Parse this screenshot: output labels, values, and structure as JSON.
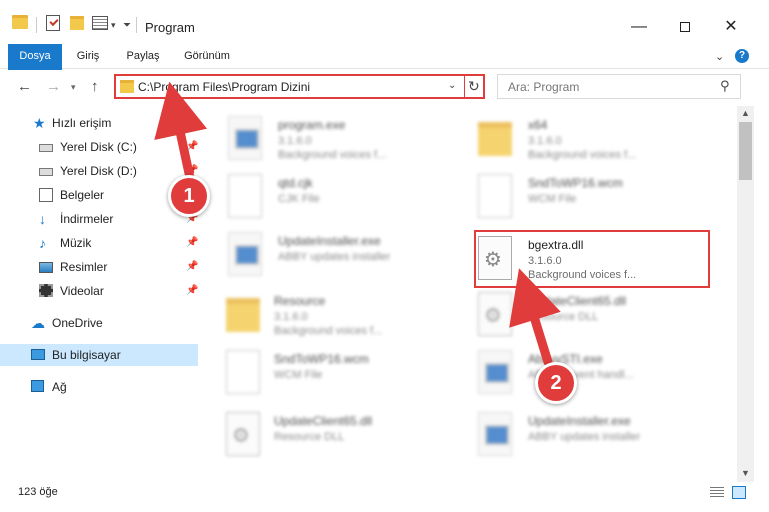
{
  "window": {
    "title": "Program",
    "minimize": "—",
    "close": "✕"
  },
  "ribbon": {
    "tabs": [
      "Dosya",
      "Giriş",
      "Paylaş",
      "Görünüm"
    ],
    "help": "?"
  },
  "address": {
    "path": "C:\\Program Files\\Program Dizini"
  },
  "search": {
    "placeholder": "Ara: Program"
  },
  "sidebar": {
    "items": [
      {
        "label": "Hızlı erişim",
        "icon": "star-icon"
      },
      {
        "label": "Yerel Disk (C:)",
        "icon": "drive-icon"
      },
      {
        "label": "Yerel Disk (D:)",
        "icon": "drive-icon"
      },
      {
        "label": "Belgeler",
        "icon": "documents-icon"
      },
      {
        "label": "İndirmeler",
        "icon": "download-icon"
      },
      {
        "label": "Müzik",
        "icon": "music-icon"
      },
      {
        "label": "Resimler",
        "icon": "pictures-icon"
      },
      {
        "label": "Videolar",
        "icon": "video-icon"
      },
      {
        "label": "OneDrive",
        "icon": "cloud-icon"
      },
      {
        "label": "Bu bilgisayar",
        "icon": "computer-icon"
      },
      {
        "label": "Ağ",
        "icon": "network-icon"
      }
    ]
  },
  "files": [
    {
      "name": "program.exe",
      "line1": "3.1.6.0",
      "line2": "Background voices f...",
      "type": "exe"
    },
    {
      "name": "x64",
      "line1": "3.1.6.0",
      "line2": "Background voices f...",
      "type": "folder"
    },
    {
      "name": "qtd.cjk",
      "line1": "CJK File",
      "line2": "",
      "type": "blank"
    },
    {
      "name": "SndToWP16.wcm",
      "line1": "WCM File",
      "line2": "",
      "type": "blank"
    },
    {
      "name": "UpdateInstaller.exe",
      "line1": "ABBY updates installer",
      "line2": "",
      "type": "exe"
    },
    {
      "name": "bgextra.dll",
      "line1": "3.1.6.0",
      "line2": "Background voices f...",
      "type": "dll"
    },
    {
      "name": "Resource",
      "line1": "3.1.6.0",
      "line2": "Background voices f...",
      "type": "folder"
    },
    {
      "name": "UpdateClient65.dll",
      "line1": "Resource DLL",
      "line2": "",
      "type": "dll"
    },
    {
      "name": "SndToWP16.wcm",
      "line1": "WCM File",
      "line2": "",
      "type": "blank"
    },
    {
      "name": "AbbyySTI.exe",
      "line1": "ABBYY event handl...",
      "line2": "",
      "type": "exe"
    },
    {
      "name": "UpdateClient65.dll",
      "line1": "Resource DLL",
      "line2": "",
      "type": "dll"
    },
    {
      "name": "UpdateInstaller.exe",
      "line1": "ABBY updates installer",
      "line2": "",
      "type": "exe"
    }
  ],
  "status": {
    "count": "123 öğe"
  },
  "callouts": {
    "one": "1",
    "two": "2",
    "color": "#e03c3c"
  }
}
